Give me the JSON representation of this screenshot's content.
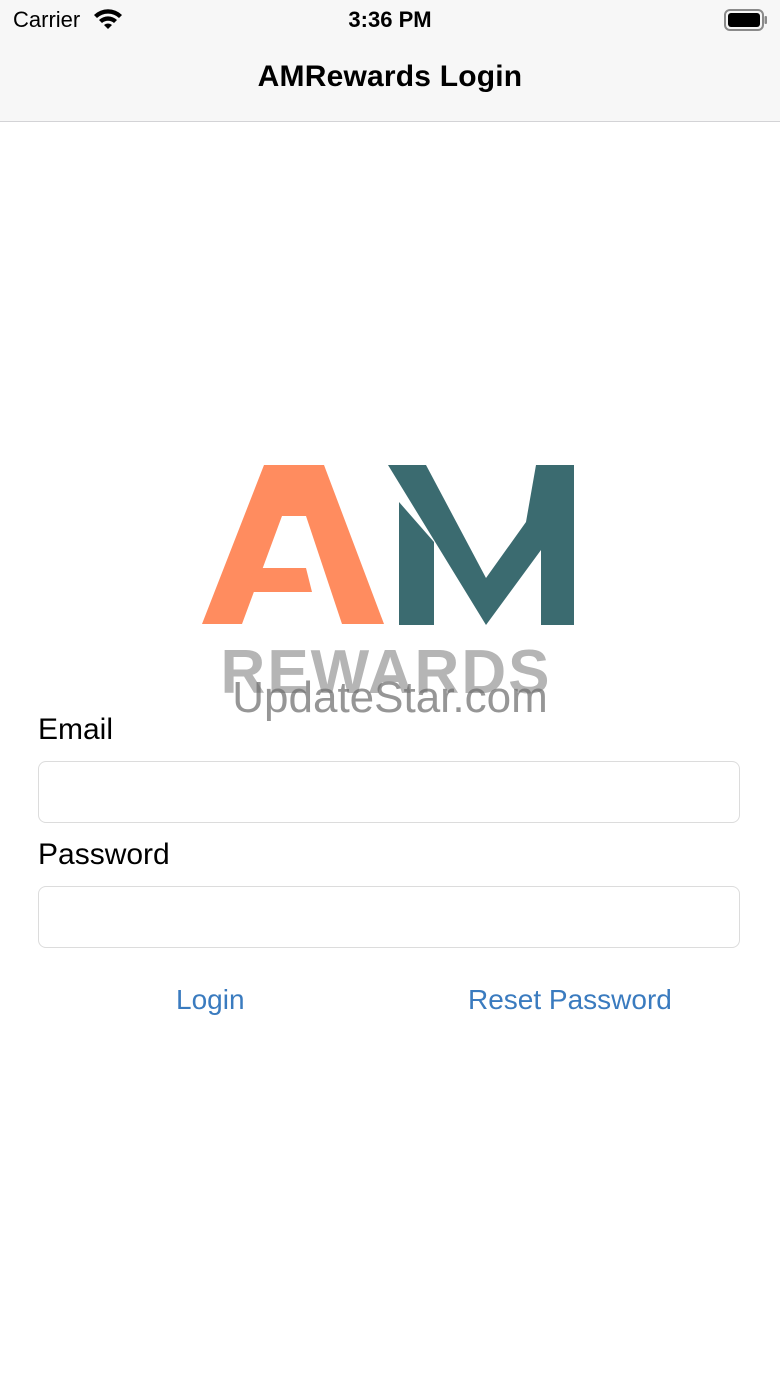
{
  "status_bar": {
    "carrier": "Carrier",
    "time": "3:36 PM",
    "wifi_icon": "wifi-icon",
    "battery_icon": "battery-icon"
  },
  "nav": {
    "title": "AMRewards Login"
  },
  "logo": {
    "letters": "AM",
    "word": "REWARDS",
    "colors": {
      "a": "#ff8c5f",
      "m": "#3b6b70",
      "word": "#b5b5b5"
    }
  },
  "watermark": "UpdateStar.com",
  "form": {
    "email": {
      "label": "Email",
      "value": "",
      "placeholder": ""
    },
    "password": {
      "label": "Password",
      "value": "",
      "placeholder": ""
    }
  },
  "actions": {
    "login_label": "Login",
    "reset_label": "Reset Password"
  },
  "colors": {
    "link": "#3a7bbf",
    "bar_background": "#f7f7f7"
  }
}
